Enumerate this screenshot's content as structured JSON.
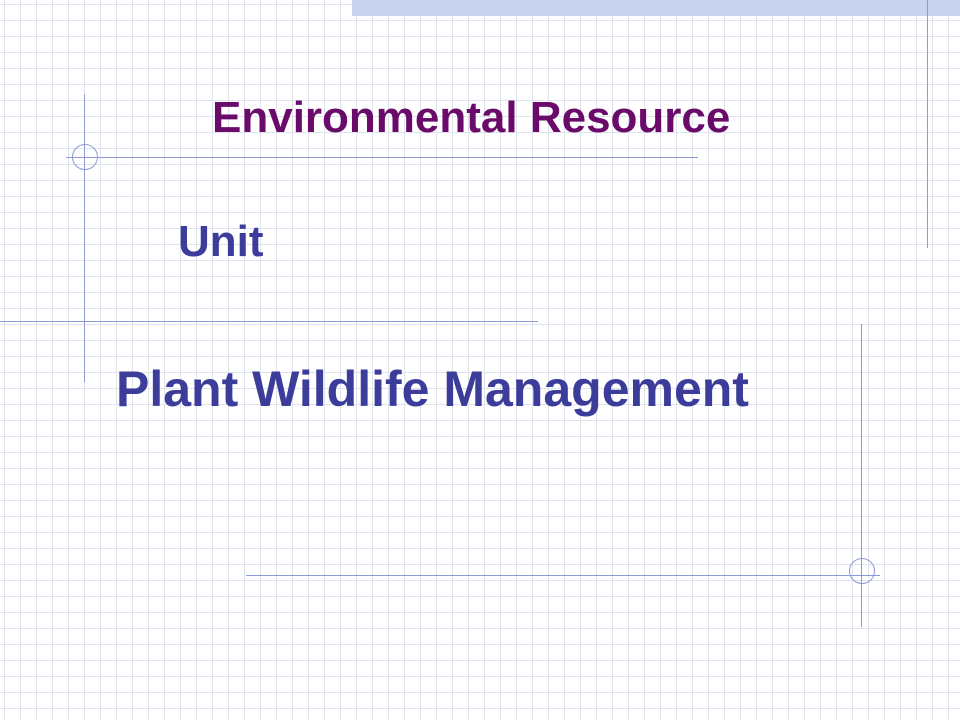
{
  "slide": {
    "title_line1": "Environmental Resource",
    "title_line2": "Unit",
    "subtitle": "Plant Wildlife Management"
  },
  "colors": {
    "background": "#ffffff",
    "grid": "#dfe3ec",
    "accent_bar": "#c9d3ee",
    "decor_line": "#8e9ad4",
    "title_line1": "#6a0a6a",
    "title_line2": "#3c3d9b",
    "subtitle": "#3c3d9b"
  }
}
